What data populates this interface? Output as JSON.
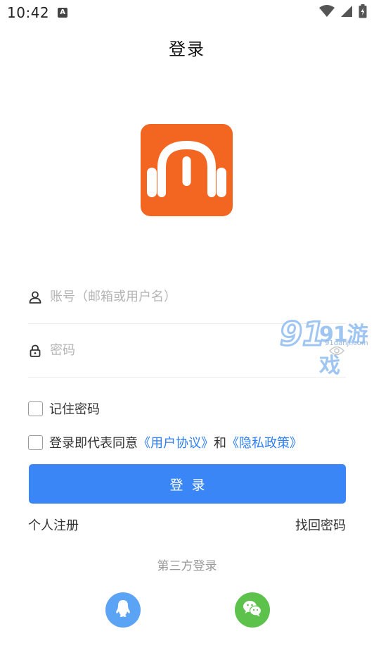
{
  "status_bar": {
    "time": "10:42",
    "notification_badge": "A",
    "icons": [
      "wifi-icon",
      "signal-icon",
      "battery-icon"
    ]
  },
  "page": {
    "title": "登录"
  },
  "form": {
    "account_placeholder": "账号（邮箱或用户名）",
    "account_value": "",
    "password_placeholder": "密码",
    "password_value": "",
    "remember_label": "记住密码",
    "remember_checked": false,
    "agree_prefix": "登录即代表同意",
    "user_agreement": "《用户协议》",
    "agree_and": "和",
    "privacy_policy": "《隐私政策》",
    "agree_checked": false,
    "login_button": "登录"
  },
  "links": {
    "register": "个人注册",
    "forgot_password": "找回密码"
  },
  "third_party": {
    "label": "第三方登录",
    "providers": [
      "qq-icon",
      "wechat-icon"
    ]
  },
  "watermark": {
    "main": "91游戏",
    "sub": "91danji.com"
  },
  "colors": {
    "accent": "#3a86f7",
    "logo_bg": "#f26622",
    "link": "#2f7ef0",
    "qq": "#5aa3f5",
    "wechat": "#5cc24c"
  }
}
